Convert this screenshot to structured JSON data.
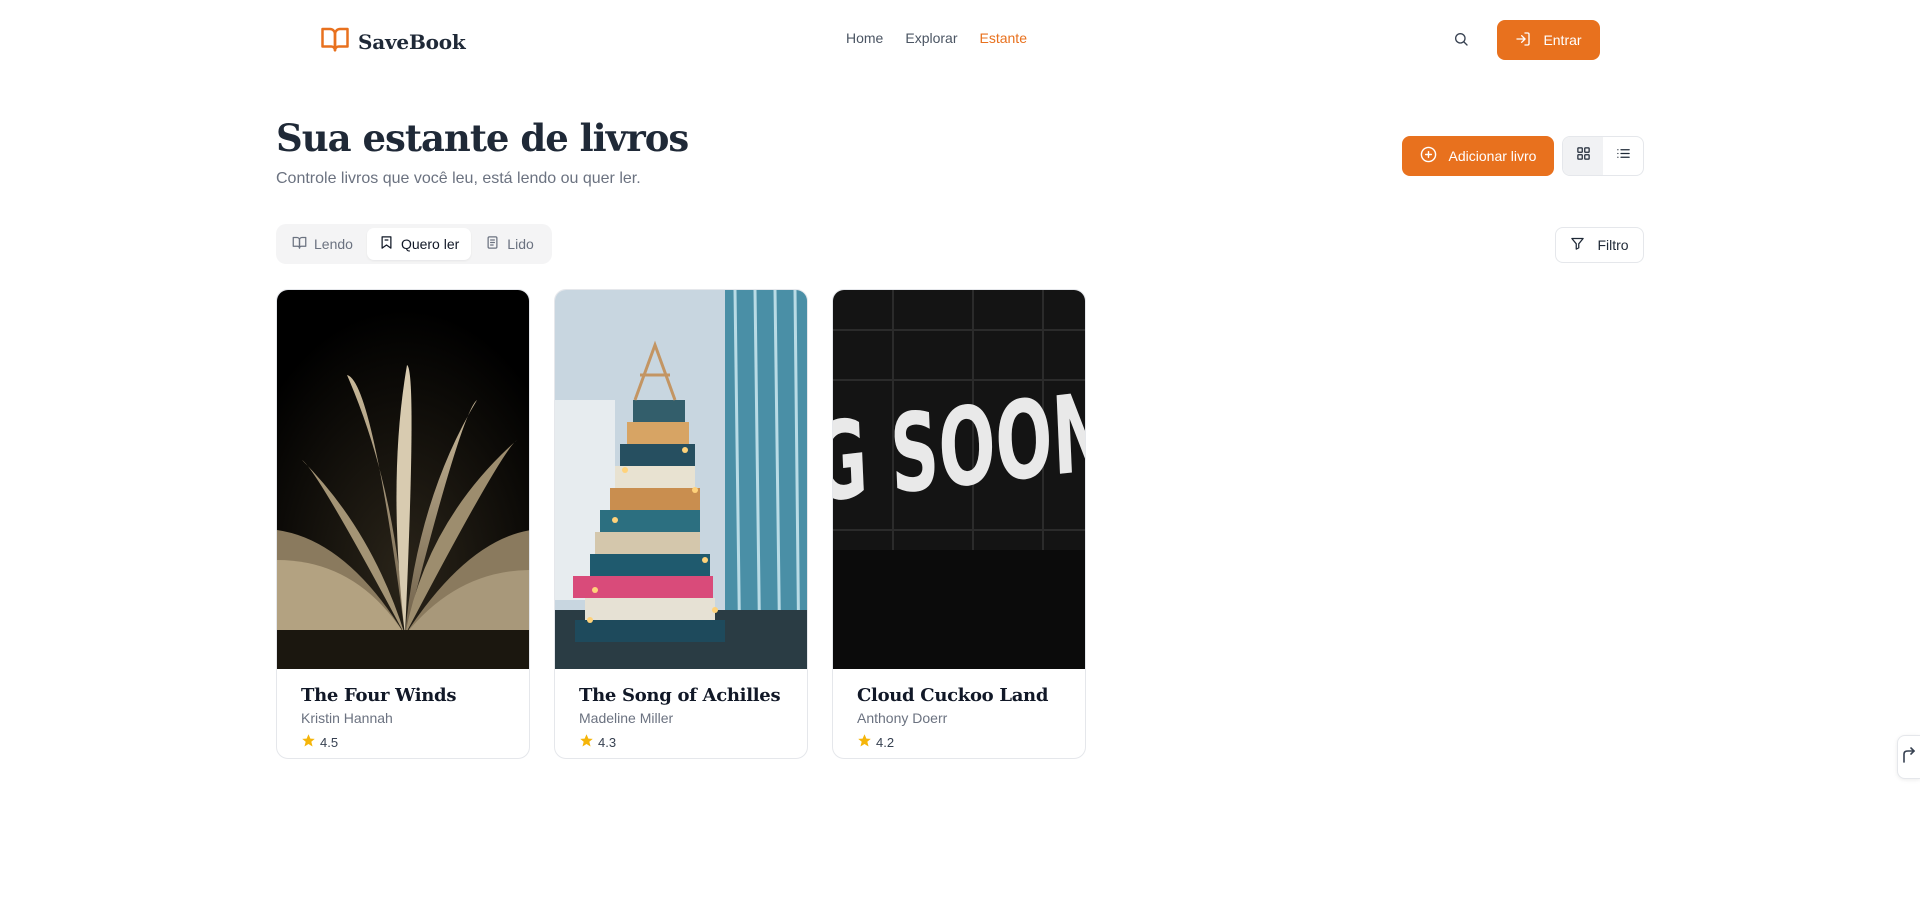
{
  "brand": {
    "name": "SaveBook",
    "accent": "#e8711e"
  },
  "nav": {
    "items": [
      {
        "label": "Home",
        "active": false
      },
      {
        "label": "Explorar",
        "active": false
      },
      {
        "label": "Estante",
        "active": true
      }
    ],
    "login_label": "Entrar"
  },
  "page": {
    "title": "Sua estante de livros",
    "subtitle": "Controle livros que você leu, está lendo ou quer ler.",
    "add_label": "Adicionar livro",
    "view_mode": "grid"
  },
  "tabs": [
    {
      "label": "Lendo",
      "icon": "book-open-icon",
      "active": false
    },
    {
      "label": "Quero ler",
      "icon": "bookmark-icon",
      "active": true
    },
    {
      "label": "Lido",
      "icon": "notebook-icon",
      "active": false
    }
  ],
  "filter_label": "Filtro",
  "books": [
    {
      "title": "The Four Winds",
      "author": "Kristin Hannah",
      "rating": "4.5"
    },
    {
      "title": "The Song of Achilles",
      "author": "Madeline Miller",
      "rating": "4.3"
    },
    {
      "title": "Cloud Cuckoo Land",
      "author": "Anthony Doerr",
      "rating": "4.2",
      "cover_text": "G SOON"
    }
  ]
}
